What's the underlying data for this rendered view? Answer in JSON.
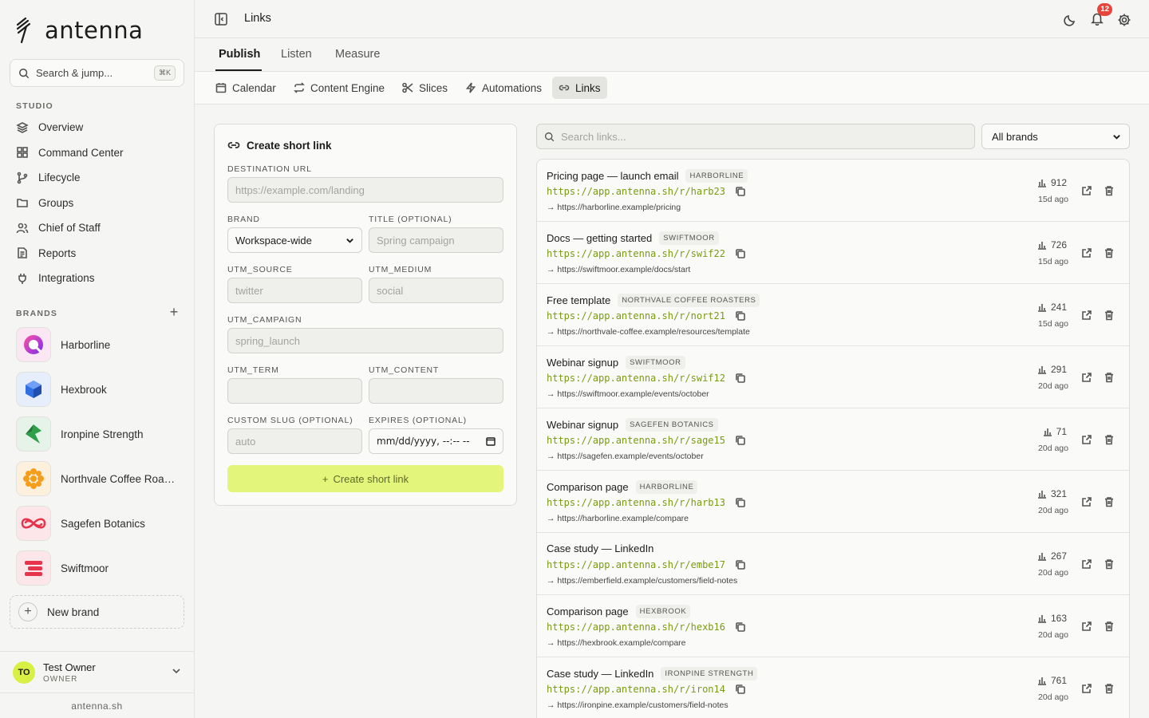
{
  "app": {
    "name": "antenna",
    "domain": "antenna.sh"
  },
  "sidebar": {
    "search_label": "Search & jump...",
    "search_shortcut": "⌘K",
    "studio_label": "STUDIO",
    "nav": [
      {
        "label": "Overview",
        "icon": "layers-icon"
      },
      {
        "label": "Command Center",
        "icon": "grid-icon"
      },
      {
        "label": "Lifecycle",
        "icon": "branch-icon"
      },
      {
        "label": "Groups",
        "icon": "folder-icon"
      },
      {
        "label": "Chief of Staff",
        "icon": "people-icon"
      },
      {
        "label": "Reports",
        "icon": "document-icon"
      },
      {
        "label": "Integrations",
        "icon": "plug-icon"
      }
    ],
    "brands_label": "BRANDS",
    "brands": [
      {
        "label": "Harborline",
        "color": "#a23ce0"
      },
      {
        "label": "Hexbrook",
        "color": "#2f6fe0"
      },
      {
        "label": "Ironpine Strength",
        "color": "#2fa04a"
      },
      {
        "label": "Northvale Coffee Roasters",
        "color": "#f59e1b"
      },
      {
        "label": "Sagefen Botanics",
        "color": "#e5344b"
      },
      {
        "label": "Swiftmoor",
        "color": "#e5344b"
      }
    ],
    "new_brand_label": "New brand",
    "user": {
      "initials": "TO",
      "name": "Test Owner",
      "role": "OWNER"
    }
  },
  "header": {
    "title": "Links",
    "notification_count": "12"
  },
  "main_tabs": [
    {
      "label": "Publish"
    },
    {
      "label": "Listen"
    },
    {
      "label": "Measure"
    }
  ],
  "sub_tabs": [
    {
      "label": "Calendar"
    },
    {
      "label": "Content Engine"
    },
    {
      "label": "Slices"
    },
    {
      "label": "Automations"
    },
    {
      "label": "Links"
    }
  ],
  "form": {
    "title": "Create short link",
    "destination_label": "DESTINATION URL",
    "destination_placeholder": "https://example.com/landing",
    "brand_label": "BRAND",
    "brand_value": "Workspace-wide",
    "title_label": "TITLE (OPTIONAL)",
    "title_placeholder": "Spring campaign",
    "utm_source_label": "UTM_SOURCE",
    "utm_source_placeholder": "twitter",
    "utm_medium_label": "UTM_MEDIUM",
    "utm_medium_placeholder": "social",
    "utm_campaign_label": "UTM_CAMPAIGN",
    "utm_campaign_placeholder": "spring_launch",
    "utm_term_label": "UTM_TERM",
    "utm_content_label": "UTM_CONTENT",
    "slug_label": "CUSTOM SLUG (OPTIONAL)",
    "slug_placeholder": "auto",
    "expires_label": "EXPIRES (OPTIONAL)",
    "expires_value": "mm/dd/yyyy, --:-- --",
    "submit_label": "Create short link"
  },
  "links_panel": {
    "search_placeholder": "Search links...",
    "brand_filter": "All brands",
    "rows": [
      {
        "title": "Pricing page — launch email",
        "brand": "HARBORLINE",
        "short": "https://app.antenna.sh/r/harb23",
        "dest": "→ https://harborline.example/pricing",
        "clicks": "912",
        "age": "15d ago"
      },
      {
        "title": "Docs — getting started",
        "brand": "SWIFTMOOR",
        "short": "https://app.antenna.sh/r/swif22",
        "dest": "→ https://swiftmoor.example/docs/start",
        "clicks": "726",
        "age": "15d ago"
      },
      {
        "title": "Free template",
        "brand": "NORTHVALE COFFEE ROASTERS",
        "short": "https://app.antenna.sh/r/nort21",
        "dest": "→ https://northvale-coffee.example/resources/template",
        "clicks": "241",
        "age": "15d ago"
      },
      {
        "title": "Webinar signup",
        "brand": "SWIFTMOOR",
        "short": "https://app.antenna.sh/r/swif12",
        "dest": "→ https://swiftmoor.example/events/october",
        "clicks": "291",
        "age": "20d ago"
      },
      {
        "title": "Webinar signup",
        "brand": "SAGEFEN BOTANICS",
        "short": "https://app.antenna.sh/r/sage15",
        "dest": "→ https://sagefen.example/events/october",
        "clicks": "71",
        "age": "20d ago"
      },
      {
        "title": "Comparison page",
        "brand": "HARBORLINE",
        "short": "https://app.antenna.sh/r/harb13",
        "dest": "→ https://harborline.example/compare",
        "clicks": "321",
        "age": "20d ago"
      },
      {
        "title": "Case study — LinkedIn",
        "brand": "",
        "short": "https://app.antenna.sh/r/embe17",
        "dest": "→ https://emberfield.example/customers/field-notes",
        "clicks": "267",
        "age": "20d ago"
      },
      {
        "title": "Comparison page",
        "brand": "HEXBROOK",
        "short": "https://app.antenna.sh/r/hexb16",
        "dest": "→ https://hexbrook.example/compare",
        "clicks": "163",
        "age": "20d ago"
      },
      {
        "title": "Case study — LinkedIn",
        "brand": "IRONPINE STRENGTH",
        "short": "https://app.antenna.sh/r/iron14",
        "dest": "→ https://ironpine.example/customers/field-notes",
        "clicks": "761",
        "age": "20d ago"
      }
    ]
  },
  "colors": {
    "accent": "#e3f57a",
    "link_green": "#7b9a14",
    "badge_red": "#e5453b"
  }
}
